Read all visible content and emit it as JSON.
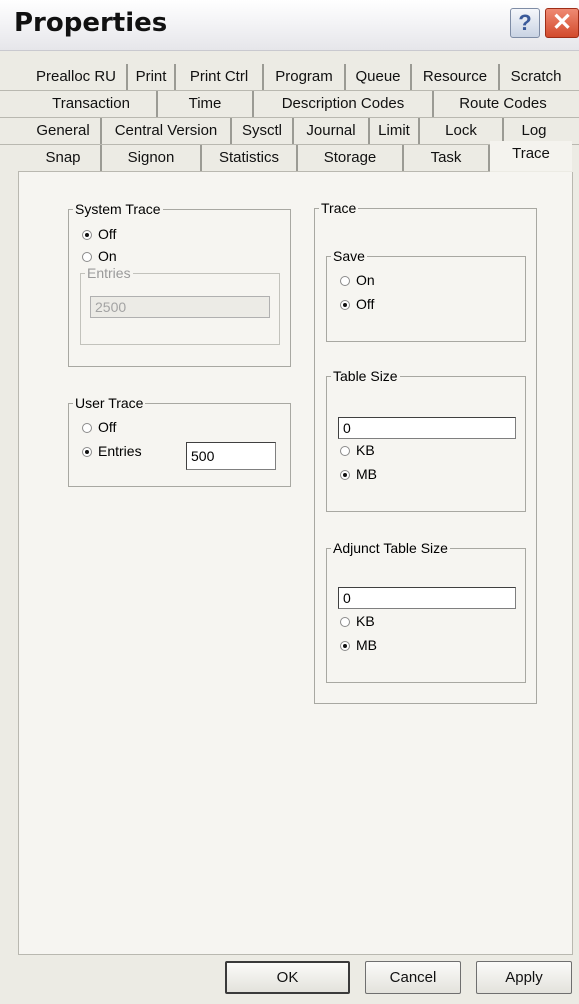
{
  "window": {
    "title": "Properties",
    "help_glyph": "?",
    "close_glyph": "✕"
  },
  "tabs": {
    "row1": [
      "Prealloc RU",
      "Print",
      "Print Ctrl",
      "Program",
      "Queue",
      "Resource",
      "Scratch"
    ],
    "row2": [
      "Transaction",
      "Time",
      "Description Codes",
      "Route Codes"
    ],
    "row3": [
      "General",
      "Central Version",
      "Sysctl",
      "Journal",
      "Limit",
      "Lock",
      "Log"
    ],
    "row4": [
      "Snap",
      "Signon",
      "Statistics",
      "Storage",
      "Task",
      "Trace"
    ],
    "active": "Trace"
  },
  "system_trace": {
    "title": "System Trace",
    "off_label": "Off",
    "on_label": "On",
    "selected": "Off",
    "entries_label": "Entries",
    "entries_value": "2500"
  },
  "user_trace": {
    "title": "User Trace",
    "off_label": "Off",
    "entries_label": "Entries",
    "selected": "Entries",
    "entries_value": "500"
  },
  "trace": {
    "title": "Trace",
    "save": {
      "title": "Save",
      "on_label": "On",
      "off_label": "Off",
      "selected": "Off"
    },
    "table_size": {
      "title": "Table Size",
      "value": "0",
      "kb_label": "KB",
      "mb_label": "MB",
      "selected": "MB"
    },
    "adjunct_table_size": {
      "title": "Adjunct Table Size",
      "value": "0",
      "kb_label": "KB",
      "mb_label": "MB",
      "selected": "MB"
    }
  },
  "buttons": {
    "ok": "OK",
    "cancel": "Cancel",
    "apply": "Apply"
  }
}
